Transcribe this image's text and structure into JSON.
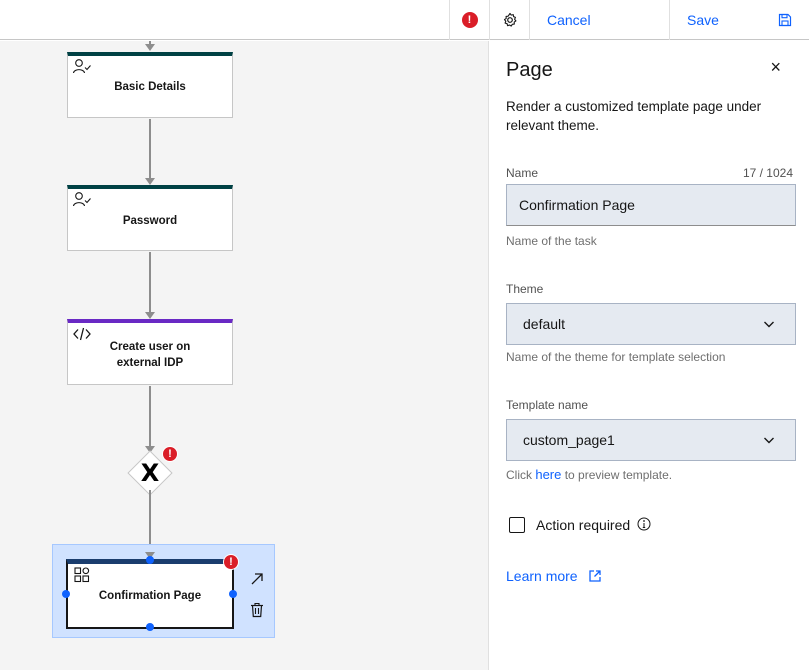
{
  "toolbar": {
    "cancel_label": "Cancel",
    "save_label": "Save",
    "error_icon": "error-icon",
    "settings_icon": "gear-icon",
    "save_icon": "floppy-disk-icon"
  },
  "flow": {
    "nodes": [
      {
        "label": "Basic Details",
        "icon": "user-check-icon",
        "accent": "#004144"
      },
      {
        "label": "Password",
        "icon": "user-check-icon",
        "accent": "#004144"
      },
      {
        "label_line1": "Create user on",
        "label_line2": "external IDP",
        "icon": "code-icon",
        "accent": "#6929c4"
      },
      {
        "label": "X",
        "type": "exclusive-gateway",
        "error": "!"
      },
      {
        "label": "Confirmation Page",
        "icon": "template-icon",
        "accent": "#1a3d6e",
        "error": "!"
      }
    ],
    "selected_actions": [
      "open-icon",
      "trash-icon"
    ]
  },
  "panel": {
    "title": "Page",
    "close_glyph": "×",
    "description": "Render a customized template page under relevant theme.",
    "name": {
      "label": "Name",
      "count": "17 / 1024",
      "value": "Confirmation Page",
      "helper": "Name of the task"
    },
    "theme": {
      "label": "Theme",
      "value": "default",
      "helper": "Name of the theme for template selection"
    },
    "template": {
      "label": "Template name",
      "value": "custom_page1",
      "helper_prefix": "Click ",
      "helper_link": "here",
      "helper_suffix": " to preview template."
    },
    "action_required": {
      "label": "Action required",
      "checked": false,
      "info_icon": "info-icon"
    },
    "learn_more": "Learn more",
    "colors": {
      "link": "#0f62fe",
      "error": "#da1e28",
      "selection": "#0f62fe"
    }
  }
}
